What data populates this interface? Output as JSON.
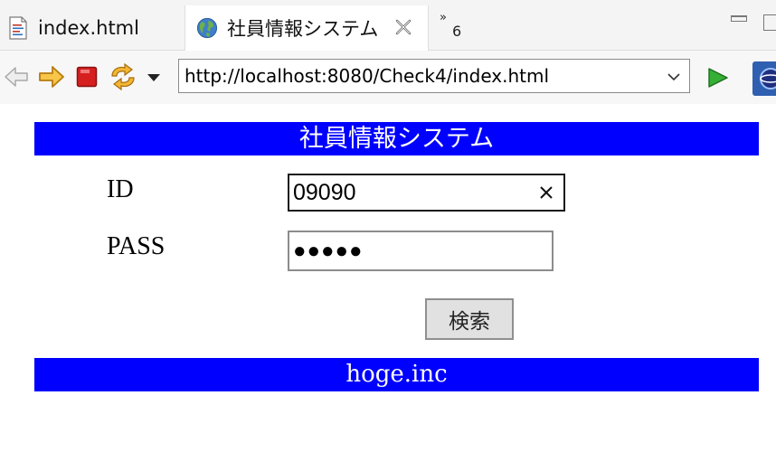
{
  "tabs": [
    {
      "label": "index.html",
      "icon": "html-file-icon",
      "active": false
    },
    {
      "label": "社員情報システム",
      "icon": "globe-icon",
      "active": true
    }
  ],
  "tab_overflow": {
    "icon": "chevron-double-right-icon",
    "count": "6"
  },
  "toolbar": {
    "back_icon": "back-arrow-icon",
    "forward_icon": "forward-arrow-icon",
    "stop_icon": "stop-icon",
    "refresh_icon": "refresh-icon",
    "menu_icon": "dropdown-triangle-icon",
    "url": "http://localhost:8080/Check4/index.html",
    "go_icon": "go-play-icon"
  },
  "page": {
    "header_title": "社員情報システム",
    "id_label": "ID",
    "id_value": "09090",
    "pass_label": "PASS",
    "pass_value": "●●●●●",
    "search_button": "検索",
    "footer": "hoge.inc"
  },
  "colors": {
    "banner_bg": "#0000ff",
    "banner_text": "#ffffff",
    "go_green": "#2ea02e",
    "stop_red": "#d62020",
    "forward_orange": "#e8a21a"
  }
}
